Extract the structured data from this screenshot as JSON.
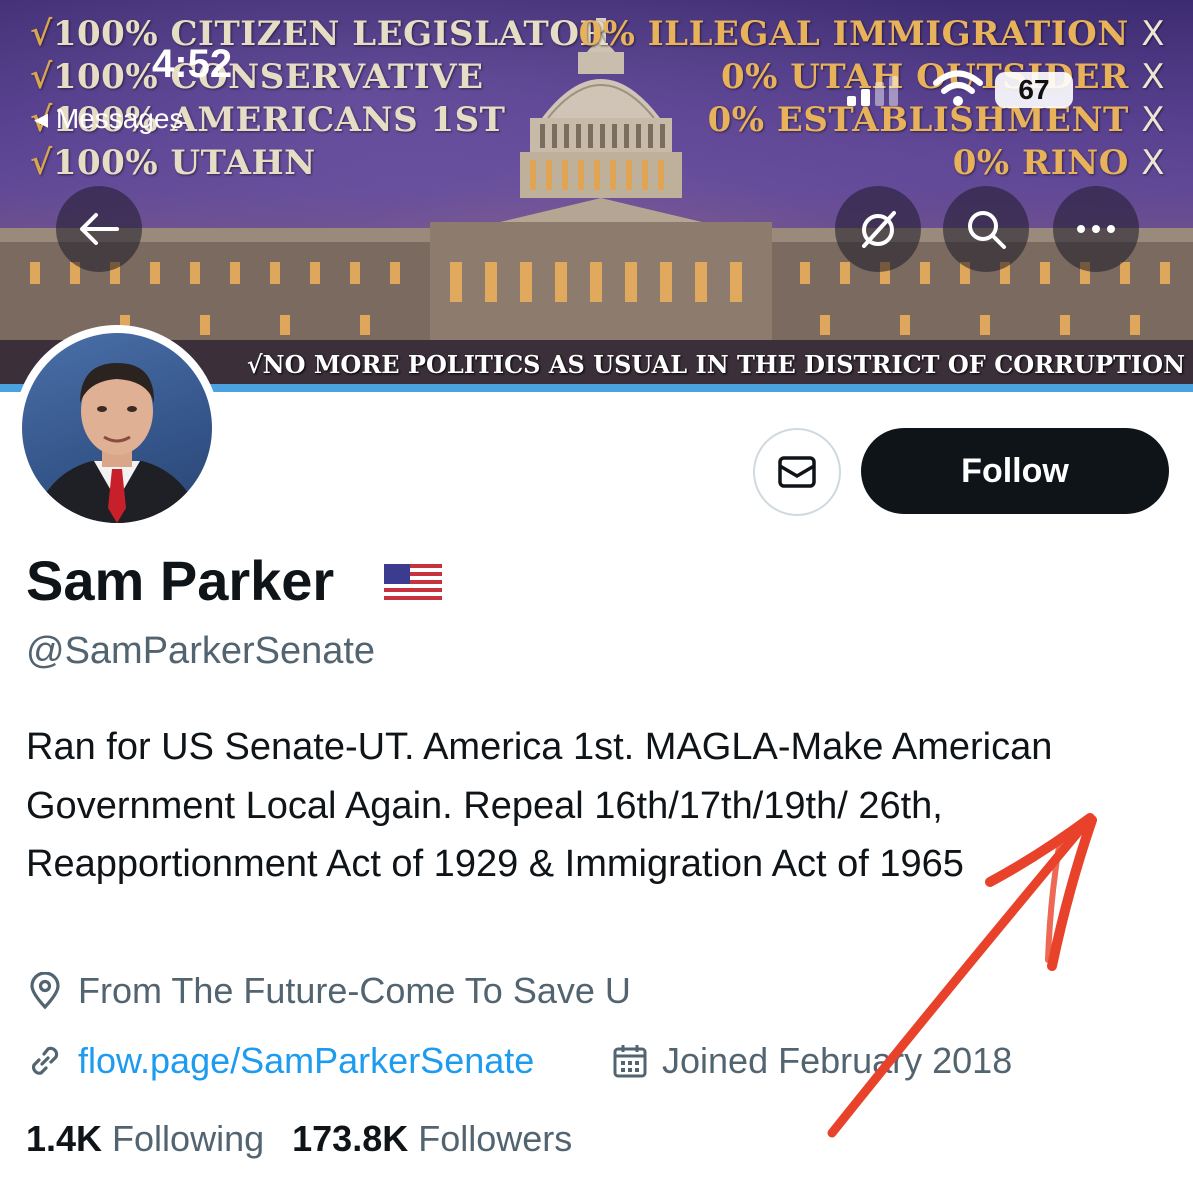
{
  "banner": {
    "left_lines": [
      "100% CITIZEN LEGISLATOR",
      "100% CONSERVATIVE",
      "100% AMERICANS 1ST",
      "100% UTAHN"
    ],
    "right_lines": [
      "0% ILLEGAL IMMIGRATION",
      "0% UTAH OUTSIDER",
      "0% ESTABLISHMENT",
      "0% RINO"
    ],
    "check_glyph": "√",
    "x_glyph": "X",
    "motto": "√NO MORE POLITICS AS USUAL IN THE DISTRICT OF CORRUPTION"
  },
  "status_bar": {
    "time": "4:52",
    "back_label": "◂ Messages",
    "battery": "67"
  },
  "profile": {
    "name": "Sam Parker",
    "handle": "@SamParkerSenate",
    "bio": "Ran for US Senate-UT. America 1st. MAGLA-Make American Government Local Again. Repeal 16th/17th/19th/ 26th, Reapportionment Act of 1929 & Immigration Act of 1965",
    "location": "From The Future-Come To Save U",
    "website": "flow.page/SamParkerSenate",
    "joined": "Joined February 2018",
    "following_count": "1.4K",
    "following_label": "Following",
    "followers_count": "173.8K",
    "followers_label": "Followers"
  },
  "actions": {
    "follow_label": "Follow"
  },
  "icons": {
    "back": "arrow-left-icon",
    "translate": "grok-icon",
    "search": "search-icon",
    "more": "more-icon",
    "message": "envelope-icon",
    "location": "location-pin-icon",
    "link": "link-icon",
    "calendar": "calendar-icon"
  },
  "colors": {
    "accent_link": "#1d9bf0",
    "follow_bg": "#0f1419",
    "secondary_text": "#536471",
    "annotation": "#e8432a"
  }
}
